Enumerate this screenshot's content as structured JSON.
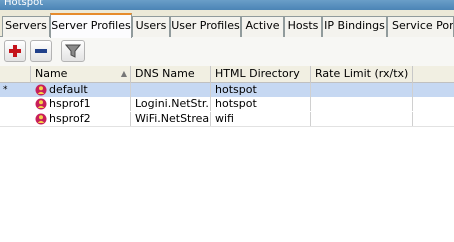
{
  "window": {
    "title": "Hotspot"
  },
  "tabs": [
    {
      "label": "Servers",
      "active": false
    },
    {
      "label": "Server Profiles",
      "active": true
    },
    {
      "label": "Users",
      "active": false
    },
    {
      "label": "User Profiles",
      "active": false
    },
    {
      "label": "Active",
      "active": false
    },
    {
      "label": "Hosts",
      "active": false
    },
    {
      "label": "IP Bindings",
      "active": false
    },
    {
      "label": "Service Ports",
      "active": false
    }
  ],
  "toolbar": {
    "add_icon": "plus-icon",
    "remove_icon": "minus-icon",
    "filter_icon": "filter-icon",
    "colors": {
      "add": "#c4131b",
      "remove": "#1f3f8a"
    }
  },
  "table": {
    "columns": [
      "Name",
      "DNS Name",
      "HTML Directory",
      "Rate Limit (rx/tx)"
    ],
    "sort_indicator": "▲",
    "rows": [
      {
        "flag": "*",
        "name": "default",
        "dns_name": "",
        "html_directory": "hotspot",
        "rate_limit": "",
        "selected": true
      },
      {
        "flag": "",
        "name": "hsprof1",
        "dns_name": "Logini.NetStr...",
        "html_directory": "hotspot",
        "rate_limit": "",
        "selected": false
      },
      {
        "flag": "",
        "name": "hsprof2",
        "dns_name": "WiFi.NetStrea...",
        "html_directory": "wifi",
        "rate_limit": "",
        "selected": false
      }
    ],
    "selection_color": "#c6d8f2"
  }
}
